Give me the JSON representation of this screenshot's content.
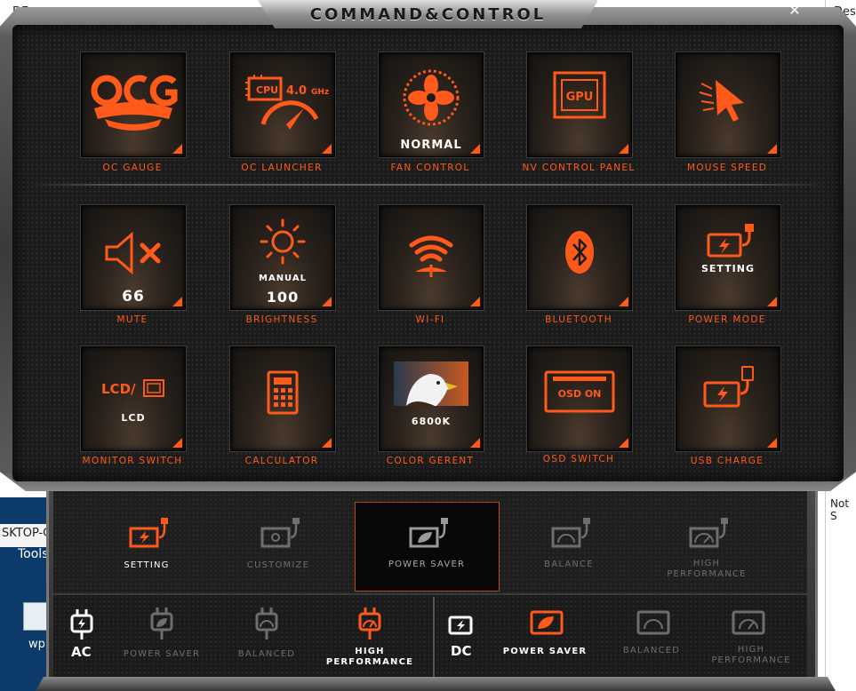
{
  "window": {
    "title": "COMMAND&CONTROL",
    "close_glyph": "✕"
  },
  "background": {
    "top_left_text": "DE",
    "top_right_text": "Desc",
    "left_strip_text": "SKTOP-C",
    "left_tools_text": "Tools",
    "left_icon_label": "wp",
    "right_bottom_text": "Not S"
  },
  "tiles": [
    {
      "label": "OC GAUGE",
      "icon": "ocg-logo-icon",
      "value": ""
    },
    {
      "label": "OC LAUNCHER",
      "icon": "cpu-gauge-icon",
      "value": "",
      "cpu_text": "CPU",
      "freq_value": "4.0",
      "freq_unit": "GHz"
    },
    {
      "label": "FAN CONTROL",
      "icon": "fan-icon",
      "value": "NORMAL"
    },
    {
      "label": "NV CONTROL PANEL",
      "icon": "gpu-icon",
      "value": "",
      "gpu_text": "GPU"
    },
    {
      "label": "MOUSE SPEED",
      "icon": "cursor-speed-icon",
      "value": ""
    },
    {
      "label": "MUTE",
      "icon": "speaker-mute-icon",
      "value": "66"
    },
    {
      "label": "BRIGHTNESS",
      "icon": "sun-icon",
      "value": "100",
      "sub": "MANUAL"
    },
    {
      "label": "WI-FI",
      "icon": "wifi-icon",
      "value": ""
    },
    {
      "label": "BLUETOOTH",
      "icon": "bluetooth-icon",
      "value": ""
    },
    {
      "label": "POWER MODE",
      "icon": "battery-plug-icon",
      "value": "",
      "sub": "SETTING"
    },
    {
      "label": "MONITOR SWITCH",
      "icon": "lcd-switch-icon",
      "value": "LCD",
      "lcd_text": "LCD/"
    },
    {
      "label": "CALCULATOR",
      "icon": "calculator-icon",
      "value": ""
    },
    {
      "label": "COLOR GERENT",
      "icon": "eagle-image-icon",
      "value": "6800K"
    },
    {
      "label": "OSD SWITCH",
      "icon": "osd-icon",
      "value": "",
      "osd_text": "OSD ON"
    },
    {
      "label": "USB CHARGE",
      "icon": "usb-charge-icon",
      "value": ""
    }
  ],
  "power_modes_top": [
    {
      "label": "SETTING",
      "state": "active",
      "icon": "battery-bolt-icon"
    },
    {
      "label": "CUSTOMIZE",
      "state": "dim",
      "icon": "battery-gear-icon"
    },
    {
      "label": "POWER SAVER",
      "state": "selected",
      "icon": "battery-leaf-icon"
    },
    {
      "label": "BALANCE",
      "state": "dim",
      "icon": "battery-gauge-icon"
    },
    {
      "label": "HIGH PERFORMANCE",
      "state": "dim",
      "icon": "battery-speed-icon"
    }
  ],
  "ac": {
    "label": "AC",
    "icon": "ac-plug-icon",
    "modes": [
      {
        "label": "POWER SAVER",
        "state": "dim"
      },
      {
        "label": "BALANCED",
        "state": "dim"
      },
      {
        "label": "HIGH PERFORMANCE",
        "state": "active"
      }
    ]
  },
  "dc": {
    "label": "DC",
    "icon": "dc-battery-icon",
    "modes": [
      {
        "label": "POWER SAVER",
        "state": "active"
      },
      {
        "label": "BALANCED",
        "state": "dim"
      },
      {
        "label": "HIGH PERFORMANCE",
        "state": "dim"
      }
    ]
  },
  "colors": {
    "accent": "#ff5a1a",
    "dim": "#6e6e6e",
    "tile_bg": "#2a221c"
  }
}
